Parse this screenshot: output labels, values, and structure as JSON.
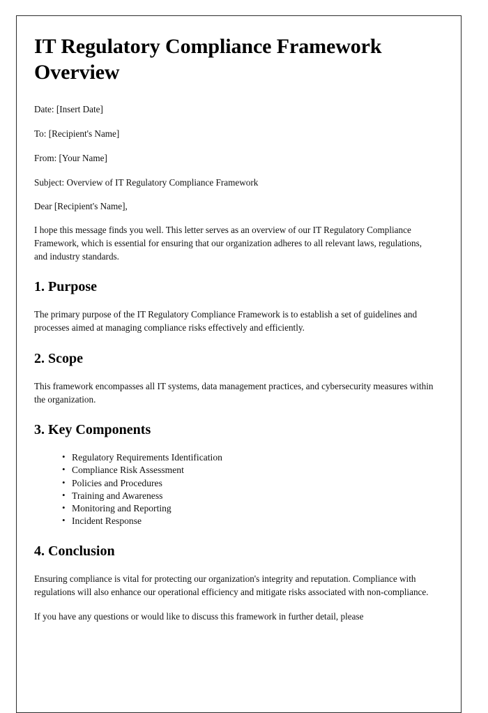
{
  "document": {
    "title": "IT Regulatory Compliance Framework Overview",
    "meta": [
      {
        "label": "Date",
        "value": "Date: [Insert Date]"
      },
      {
        "label": "To",
        "value": "To: [Recipient's Name]"
      },
      {
        "label": "From",
        "value": "From: [Your Name]"
      },
      {
        "label": "Subject",
        "value": "Subject: Overview of IT Regulatory Compliance Framework"
      }
    ],
    "salutation": "Dear [Recipient's Name],",
    "intro": "I hope this message finds you well. This letter serves as an overview of our IT Regulatory Compliance Framework, which is essential for ensuring that our organization adheres to all relevant laws, regulations, and industry standards.",
    "sections": [
      {
        "heading": "1. Purpose",
        "body": "The primary purpose of the IT Regulatory Compliance Framework is to establish a set of guidelines and processes aimed at managing compliance risks effectively and efficiently."
      },
      {
        "heading": "2. Scope",
        "body": "This framework encompasses all IT systems, data management practices, and cybersecurity measures within the organization."
      },
      {
        "heading": "3. Key Components",
        "items": [
          "Regulatory Requirements Identification",
          "Compliance Risk Assessment",
          "Policies and Procedures",
          "Training and Awareness",
          "Monitoring and Reporting",
          "Incident Response"
        ]
      },
      {
        "heading": "4. Conclusion",
        "body": "Ensuring compliance is vital for protecting our organization's integrity and reputation. Compliance with regulations will also enhance our operational efficiency and mitigate risks associated with non-compliance.",
        "closing": "If you have any questions or would like to discuss this framework in further detail, please"
      }
    ]
  }
}
